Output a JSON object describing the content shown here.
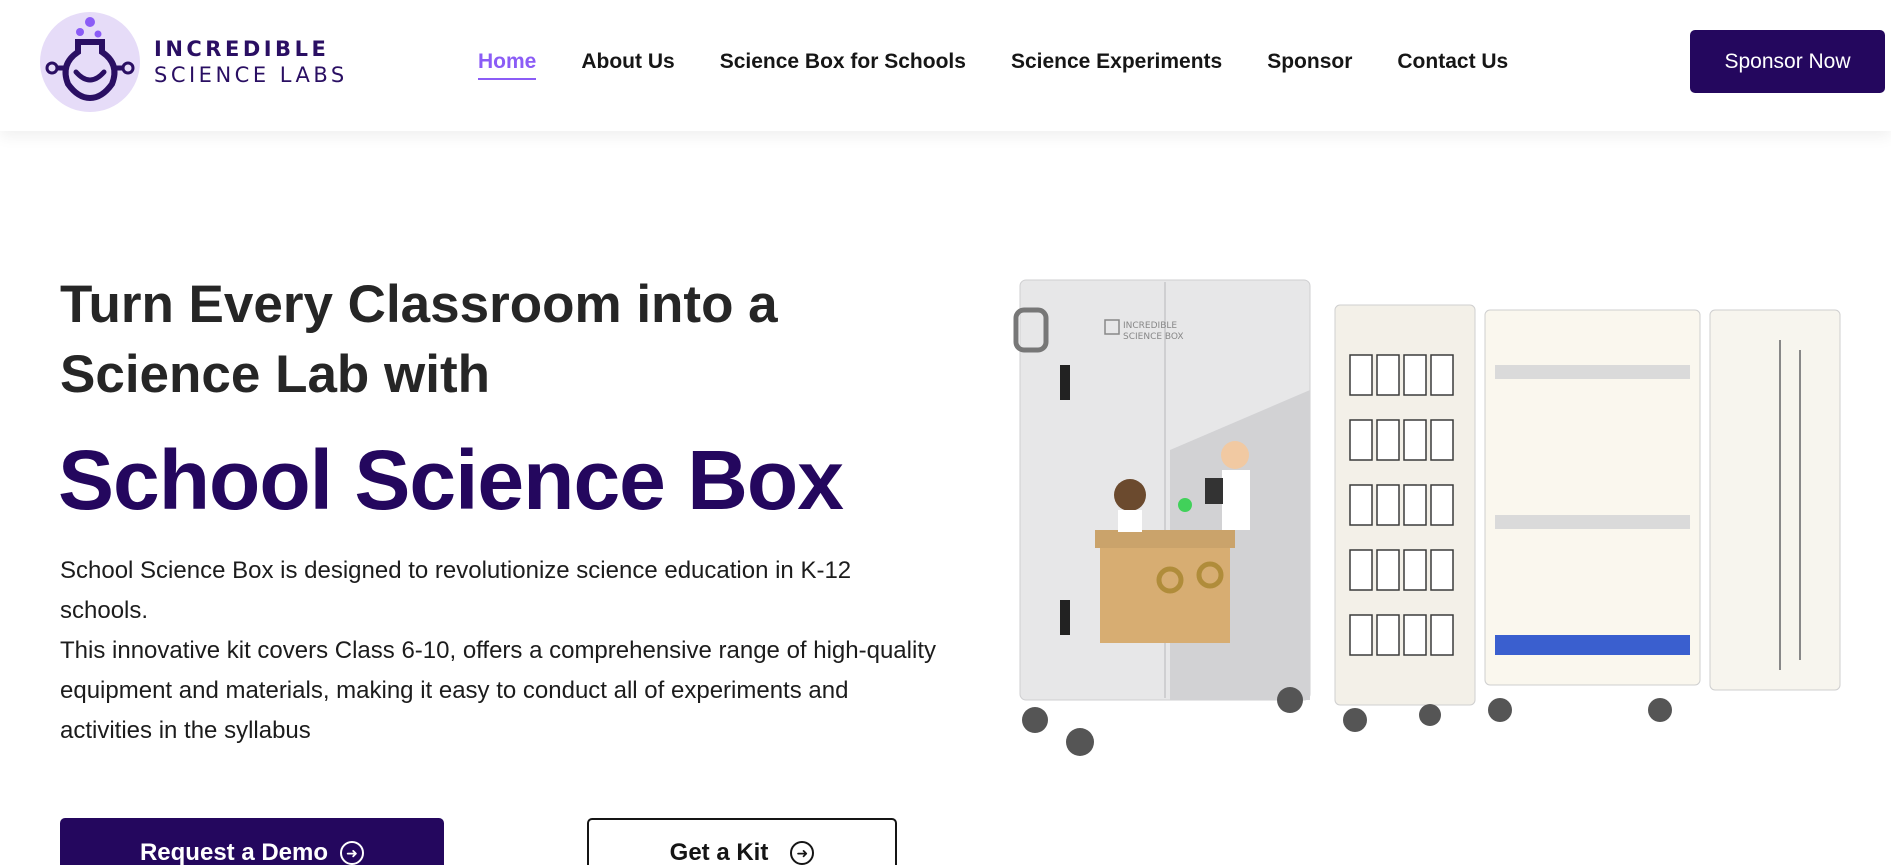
{
  "brand": {
    "name_line1": "INCREDIBLE",
    "name_line2": "SCIENCE LABS",
    "primary_color": "#24075e",
    "accent_color": "#8b5cf6",
    "logo_bg": "#e6dcf8"
  },
  "nav": {
    "items": [
      {
        "label": "Home",
        "active": true
      },
      {
        "label": "About Us"
      },
      {
        "label": "Science Box for Schools"
      },
      {
        "label": "Science Experiments"
      },
      {
        "label": "Sponsor"
      },
      {
        "label": "Contact Us"
      }
    ],
    "cta_label": "Sponsor Now"
  },
  "hero": {
    "title_line1": "Turn Every Classroom into a",
    "title_line2": "Science Lab with",
    "subtitle": "School Science Box",
    "desc_line1": "School Science Box is designed to revolutionize science education in K-12 schools.",
    "desc_line2": "This innovative kit covers Class 6-10, offers a comprehensive range of high-quality equipment and materials, making it easy to conduct all of experiments and activities in the syllabus",
    "primary_cta": "Request a Demo",
    "secondary_cta": "Get a Kit",
    "cta_icon": "circle-arrow-right-icon",
    "image_label_line1": "INCREDIBLE",
    "image_label_line2": "SCIENCE BOX"
  }
}
